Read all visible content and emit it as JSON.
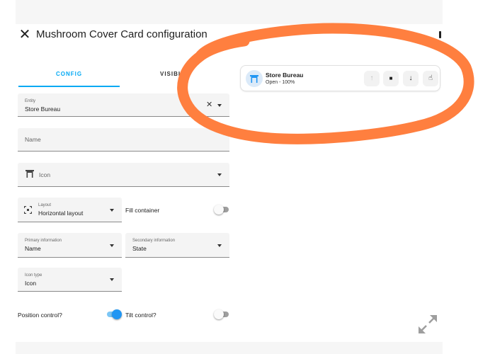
{
  "dialog": {
    "title": "Mushroom Cover Card configuration",
    "close_icon": "close-icon",
    "more_icon": "more-vertical-icon",
    "tabs": [
      {
        "label": "CONFIG",
        "active": true
      },
      {
        "label": "VISIBI",
        "active": false
      }
    ]
  },
  "form": {
    "entity": {
      "label": "Entity",
      "value": "Store Bureau",
      "clear_icon": "clear-icon"
    },
    "name": {
      "placeholder": "Name"
    },
    "icon": {
      "placeholder": "Icon",
      "icon": "window-shutter-icon"
    },
    "layout": {
      "label": "Layout",
      "value": "Horizontal layout",
      "icon": "layout-icon"
    },
    "fill_container": {
      "label": "Fill container",
      "checked": false
    },
    "primary_info": {
      "label": "Primary information",
      "value": "Name"
    },
    "secondary_info": {
      "label": "Secondary information",
      "value": "State"
    },
    "icon_type": {
      "label": "Icon type",
      "value": "Icon"
    },
    "position_control": {
      "label": "Position control?",
      "checked": true
    },
    "tilt_control": {
      "label": "Tilt control?",
      "checked": false
    }
  },
  "preview": {
    "name": "Store Bureau",
    "state": "Open - 100%",
    "icon": "window-shutter-icon",
    "icon_color": "#2196f3",
    "buttons": [
      {
        "name": "open-button",
        "icon": "arrow-up-icon",
        "glyph": "↑",
        "disabled": true
      },
      {
        "name": "stop-button",
        "icon": "stop-icon",
        "glyph": "■",
        "disabled": false
      },
      {
        "name": "close-button",
        "icon": "arrow-down-icon",
        "glyph": "↓",
        "disabled": false
      },
      {
        "name": "tilt-button",
        "icon": "hand-pointer-icon",
        "glyph": "☝",
        "disabled": false
      }
    ]
  },
  "colors": {
    "accent": "#03a9f4",
    "switch_on": "#2196f3",
    "annotation": "#ff7f3f"
  },
  "expand_icon": "expand-diagonal-icon"
}
